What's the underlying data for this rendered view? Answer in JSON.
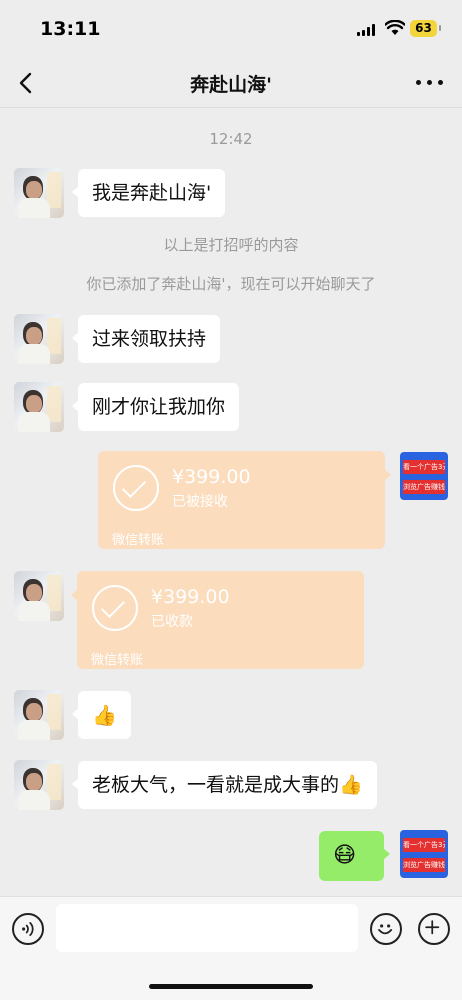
{
  "status": {
    "time": "13:11",
    "battery": "63"
  },
  "nav": {
    "title": "奔赴山海'"
  },
  "chat": {
    "timestamp": "12:42",
    "system_greeting": "以上是打招呼的内容",
    "system_added": "你已添加了奔赴山海'，现在可以开始聊天了",
    "messages": [
      {
        "text": "我是奔赴山海'"
      },
      {
        "text": "过来领取扶持"
      },
      {
        "text": "刚才你让我加你"
      },
      {
        "text": "👍"
      },
      {
        "text": "老板大气，一看就是成大事的👍"
      },
      {
        "text": "😷"
      }
    ],
    "transfers": [
      {
        "amount": "¥399.00",
        "status": "已被接收",
        "label": "微信转账"
      },
      {
        "amount": "¥399.00",
        "status": "已收款",
        "label": "微信转账"
      }
    ],
    "ad_avatar": {
      "line1": "看一个广告3元",
      "line2": "浏览广告赚钱"
    }
  },
  "input": {
    "placeholder": ""
  },
  "colors": {
    "accent_green": "#95ec69",
    "transfer_orange": "#fbdcbd",
    "background": "#ededed"
  }
}
